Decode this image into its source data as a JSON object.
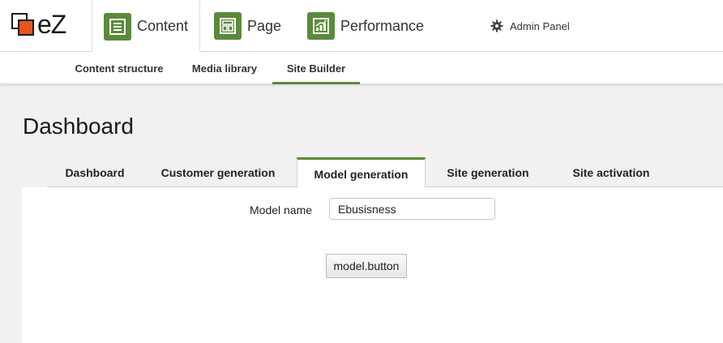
{
  "logo": {
    "text": "eZ"
  },
  "main_tabs": [
    {
      "label": "Content",
      "icon": "content-icon",
      "active": true
    },
    {
      "label": "Page",
      "icon": "page-icon",
      "active": false
    },
    {
      "label": "Performance",
      "icon": "performance-icon",
      "active": false
    }
  ],
  "admin": {
    "label": "Admin Panel",
    "icon": "gear-icon"
  },
  "sub_nav": [
    {
      "label": "Content structure",
      "active": false
    },
    {
      "label": "Media library",
      "active": false
    },
    {
      "label": "Site Builder",
      "active": true
    }
  ],
  "page": {
    "title": "Dashboard"
  },
  "content_tabs": [
    {
      "label": "Dashboard",
      "active": false
    },
    {
      "label": "Customer generation",
      "active": false
    },
    {
      "label": "Model generation",
      "active": true
    },
    {
      "label": "Site generation",
      "active": false
    },
    {
      "label": "Site activation",
      "active": false
    }
  ],
  "form": {
    "model_name_label": "Model name",
    "model_name_value": "Ebusisness",
    "button_label": "model.button"
  },
  "colors": {
    "accent_green": "#5a8a3b",
    "logo_orange": "#e8531f",
    "page_background": "#f2f1ef"
  }
}
